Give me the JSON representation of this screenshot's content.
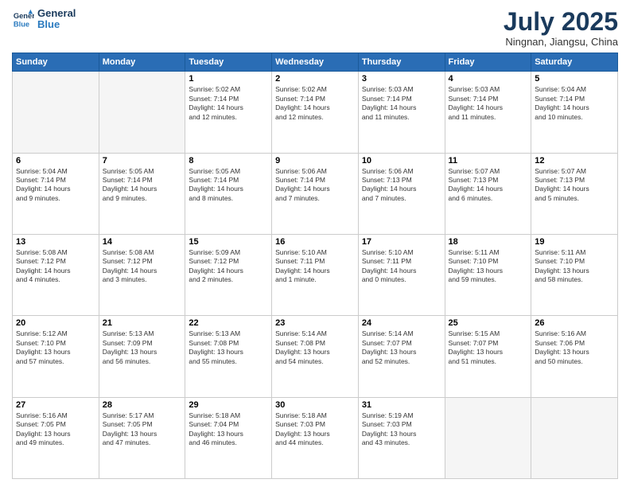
{
  "header": {
    "logo_line1": "General",
    "logo_line2": "Blue",
    "month": "July 2025",
    "location": "Ningnan, Jiangsu, China"
  },
  "weekdays": [
    "Sunday",
    "Monday",
    "Tuesday",
    "Wednesday",
    "Thursday",
    "Friday",
    "Saturday"
  ],
  "weeks": [
    [
      {
        "day": "",
        "info": ""
      },
      {
        "day": "",
        "info": ""
      },
      {
        "day": "1",
        "info": "Sunrise: 5:02 AM\nSunset: 7:14 PM\nDaylight: 14 hours\nand 12 minutes."
      },
      {
        "day": "2",
        "info": "Sunrise: 5:02 AM\nSunset: 7:14 PM\nDaylight: 14 hours\nand 12 minutes."
      },
      {
        "day": "3",
        "info": "Sunrise: 5:03 AM\nSunset: 7:14 PM\nDaylight: 14 hours\nand 11 minutes."
      },
      {
        "day": "4",
        "info": "Sunrise: 5:03 AM\nSunset: 7:14 PM\nDaylight: 14 hours\nand 11 minutes."
      },
      {
        "day": "5",
        "info": "Sunrise: 5:04 AM\nSunset: 7:14 PM\nDaylight: 14 hours\nand 10 minutes."
      }
    ],
    [
      {
        "day": "6",
        "info": "Sunrise: 5:04 AM\nSunset: 7:14 PM\nDaylight: 14 hours\nand 9 minutes."
      },
      {
        "day": "7",
        "info": "Sunrise: 5:05 AM\nSunset: 7:14 PM\nDaylight: 14 hours\nand 9 minutes."
      },
      {
        "day": "8",
        "info": "Sunrise: 5:05 AM\nSunset: 7:14 PM\nDaylight: 14 hours\nand 8 minutes."
      },
      {
        "day": "9",
        "info": "Sunrise: 5:06 AM\nSunset: 7:14 PM\nDaylight: 14 hours\nand 7 minutes."
      },
      {
        "day": "10",
        "info": "Sunrise: 5:06 AM\nSunset: 7:13 PM\nDaylight: 14 hours\nand 7 minutes."
      },
      {
        "day": "11",
        "info": "Sunrise: 5:07 AM\nSunset: 7:13 PM\nDaylight: 14 hours\nand 6 minutes."
      },
      {
        "day": "12",
        "info": "Sunrise: 5:07 AM\nSunset: 7:13 PM\nDaylight: 14 hours\nand 5 minutes."
      }
    ],
    [
      {
        "day": "13",
        "info": "Sunrise: 5:08 AM\nSunset: 7:12 PM\nDaylight: 14 hours\nand 4 minutes."
      },
      {
        "day": "14",
        "info": "Sunrise: 5:08 AM\nSunset: 7:12 PM\nDaylight: 14 hours\nand 3 minutes."
      },
      {
        "day": "15",
        "info": "Sunrise: 5:09 AM\nSunset: 7:12 PM\nDaylight: 14 hours\nand 2 minutes."
      },
      {
        "day": "16",
        "info": "Sunrise: 5:10 AM\nSunset: 7:11 PM\nDaylight: 14 hours\nand 1 minute."
      },
      {
        "day": "17",
        "info": "Sunrise: 5:10 AM\nSunset: 7:11 PM\nDaylight: 14 hours\nand 0 minutes."
      },
      {
        "day": "18",
        "info": "Sunrise: 5:11 AM\nSunset: 7:10 PM\nDaylight: 13 hours\nand 59 minutes."
      },
      {
        "day": "19",
        "info": "Sunrise: 5:11 AM\nSunset: 7:10 PM\nDaylight: 13 hours\nand 58 minutes."
      }
    ],
    [
      {
        "day": "20",
        "info": "Sunrise: 5:12 AM\nSunset: 7:10 PM\nDaylight: 13 hours\nand 57 minutes."
      },
      {
        "day": "21",
        "info": "Sunrise: 5:13 AM\nSunset: 7:09 PM\nDaylight: 13 hours\nand 56 minutes."
      },
      {
        "day": "22",
        "info": "Sunrise: 5:13 AM\nSunset: 7:08 PM\nDaylight: 13 hours\nand 55 minutes."
      },
      {
        "day": "23",
        "info": "Sunrise: 5:14 AM\nSunset: 7:08 PM\nDaylight: 13 hours\nand 54 minutes."
      },
      {
        "day": "24",
        "info": "Sunrise: 5:14 AM\nSunset: 7:07 PM\nDaylight: 13 hours\nand 52 minutes."
      },
      {
        "day": "25",
        "info": "Sunrise: 5:15 AM\nSunset: 7:07 PM\nDaylight: 13 hours\nand 51 minutes."
      },
      {
        "day": "26",
        "info": "Sunrise: 5:16 AM\nSunset: 7:06 PM\nDaylight: 13 hours\nand 50 minutes."
      }
    ],
    [
      {
        "day": "27",
        "info": "Sunrise: 5:16 AM\nSunset: 7:05 PM\nDaylight: 13 hours\nand 49 minutes."
      },
      {
        "day": "28",
        "info": "Sunrise: 5:17 AM\nSunset: 7:05 PM\nDaylight: 13 hours\nand 47 minutes."
      },
      {
        "day": "29",
        "info": "Sunrise: 5:18 AM\nSunset: 7:04 PM\nDaylight: 13 hours\nand 46 minutes."
      },
      {
        "day": "30",
        "info": "Sunrise: 5:18 AM\nSunset: 7:03 PM\nDaylight: 13 hours\nand 44 minutes."
      },
      {
        "day": "31",
        "info": "Sunrise: 5:19 AM\nSunset: 7:03 PM\nDaylight: 13 hours\nand 43 minutes."
      },
      {
        "day": "",
        "info": ""
      },
      {
        "day": "",
        "info": ""
      }
    ]
  ]
}
